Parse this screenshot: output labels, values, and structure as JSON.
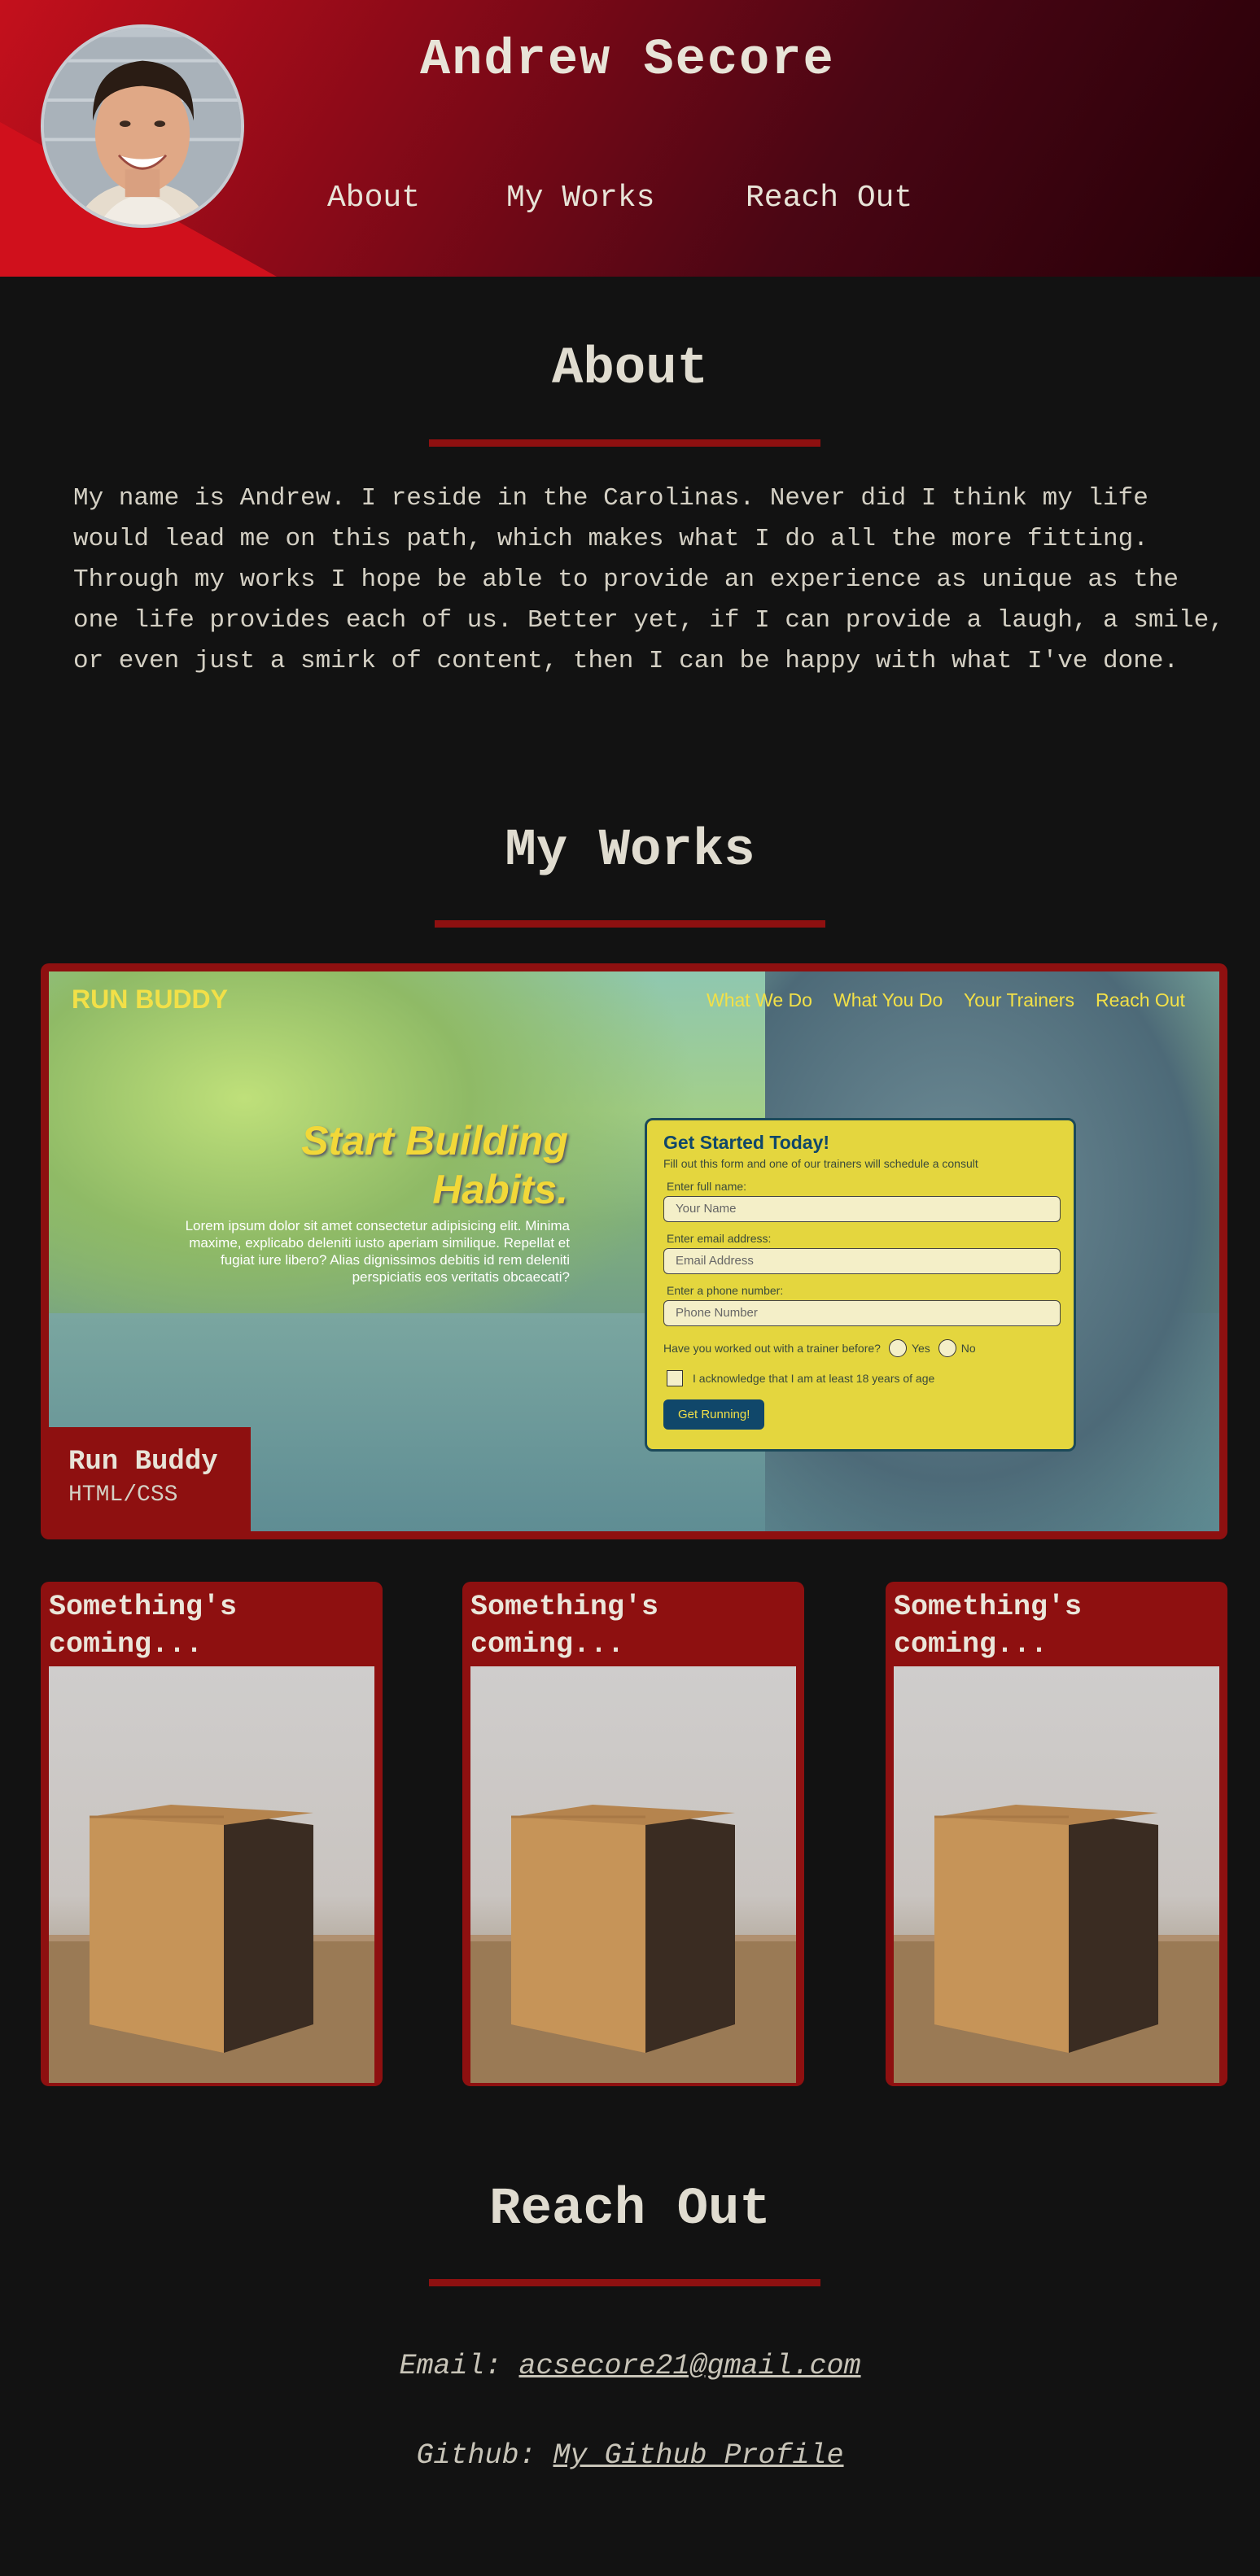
{
  "header": {
    "title": "Andrew Secore",
    "nav": [
      {
        "label": "About"
      },
      {
        "label": "My Works"
      },
      {
        "label": "Reach Out"
      }
    ]
  },
  "about": {
    "heading": "About",
    "text": "My name is Andrew. I reside in the Carolinas. Never did I think my life would lead me on this path, which makes what I do all the more fitting. Through my works I hope be able to provide an experience as unique as the one life provides each of us. Better yet, if I can provide a laugh, a smile, or even just a smirk of content, then I can be happy with what I've done."
  },
  "works": {
    "heading": "My Works",
    "featured": {
      "name": "Run Buddy",
      "tech": "HTML/CSS",
      "screenshot": {
        "logo": "RUN BUDDY",
        "nav": [
          "What We Do",
          "What You Do",
          "Your Trainers",
          "Reach Out"
        ],
        "hero_title": "Start Building Habits.",
        "hero_text": "Lorem ipsum dolor sit amet consectetur adipisicing elit. Minima maxime, explicabo deleniti iusto aperiam similique. Repellat et fugiat iure libero? Alias dignissimos debitis id rem deleniti perspiciatis eos veritatis obcaecati?",
        "form": {
          "title": "Get Started Today!",
          "subtitle": "Fill out this form and one of our trainers will schedule a consult",
          "name_label": "Enter full name:",
          "name_placeholder": "Your Name",
          "email_label": "Enter email address:",
          "email_placeholder": "Email Address",
          "phone_label": "Enter a phone number:",
          "phone_placeholder": "Phone Number",
          "trainer_question": "Have you worked out with a trainer before?",
          "yes": "Yes",
          "no": "No",
          "acknowledge": "I acknowledge that I am at least 18 years of age",
          "button": "Get Running!"
        }
      }
    },
    "placeholders": [
      {
        "title": "Something's coming..."
      },
      {
        "title": "Something's coming..."
      },
      {
        "title": "Something's coming..."
      }
    ]
  },
  "contact": {
    "heading": "Reach Out",
    "email_label": "Email:",
    "email": "acsecore21@gmail.com",
    "github_label": "Github:",
    "github_link": "My Github Profile"
  },
  "colors": {
    "accent": "#8e1010",
    "background": "#121212",
    "text": "#d8d4c8"
  }
}
